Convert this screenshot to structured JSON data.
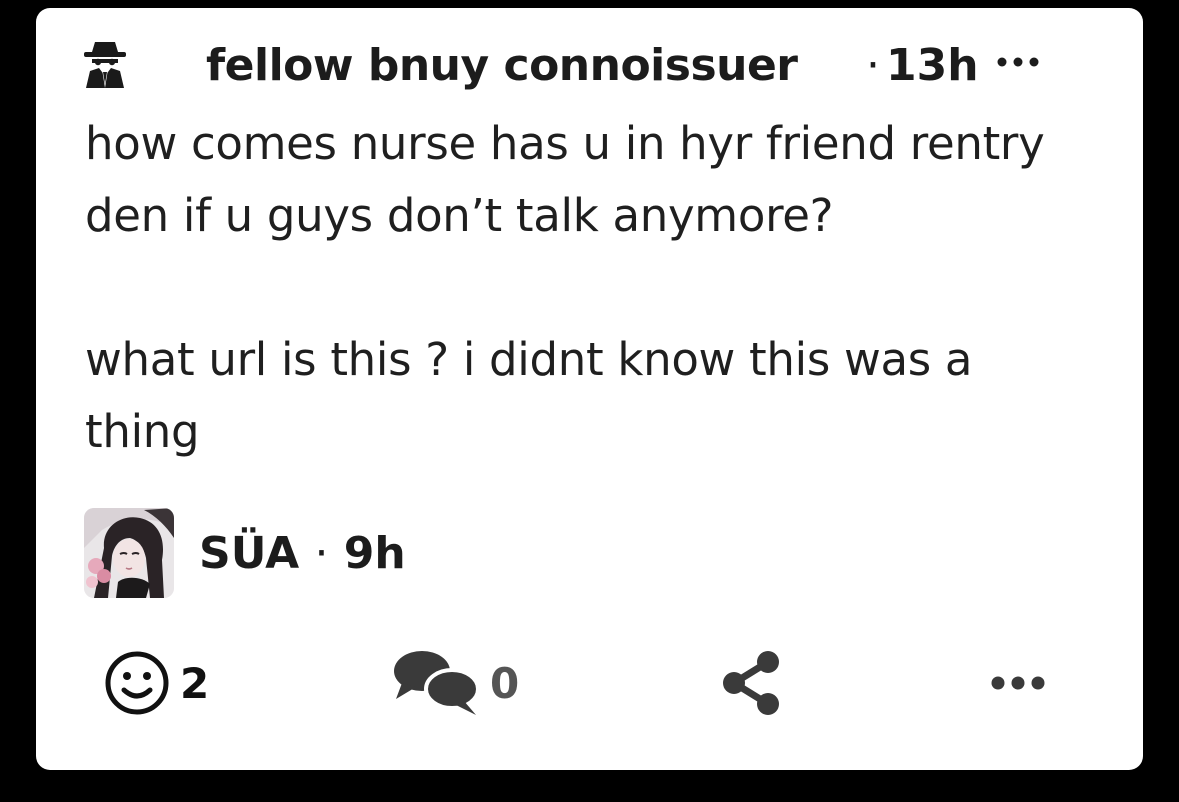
{
  "post": {
    "author": "fellow bnuy connoissuer",
    "time_separator": "·",
    "time": "13h",
    "author_icon": "spy-icon",
    "body": "how comes nurse has u in hyr friend rentry\nden if u guys don’t talk anymore?\n\nwhat url is this ? i didnt know this was a\nthing"
  },
  "reply": {
    "name": "SÜA",
    "separator": "·",
    "time": "9h"
  },
  "actions": {
    "reactions_count": "2",
    "comments_count": "0",
    "reactions_icon": "smiley-icon",
    "comments_icon": "speech-bubbles-icon",
    "share_icon": "share-icon",
    "more_icon": "more-icon"
  },
  "colors": {
    "background": "#000000",
    "card": "#ffffff",
    "text": "#1c1c1c",
    "comments_count": "#555555",
    "icon_dark": "#3a3a3a"
  }
}
